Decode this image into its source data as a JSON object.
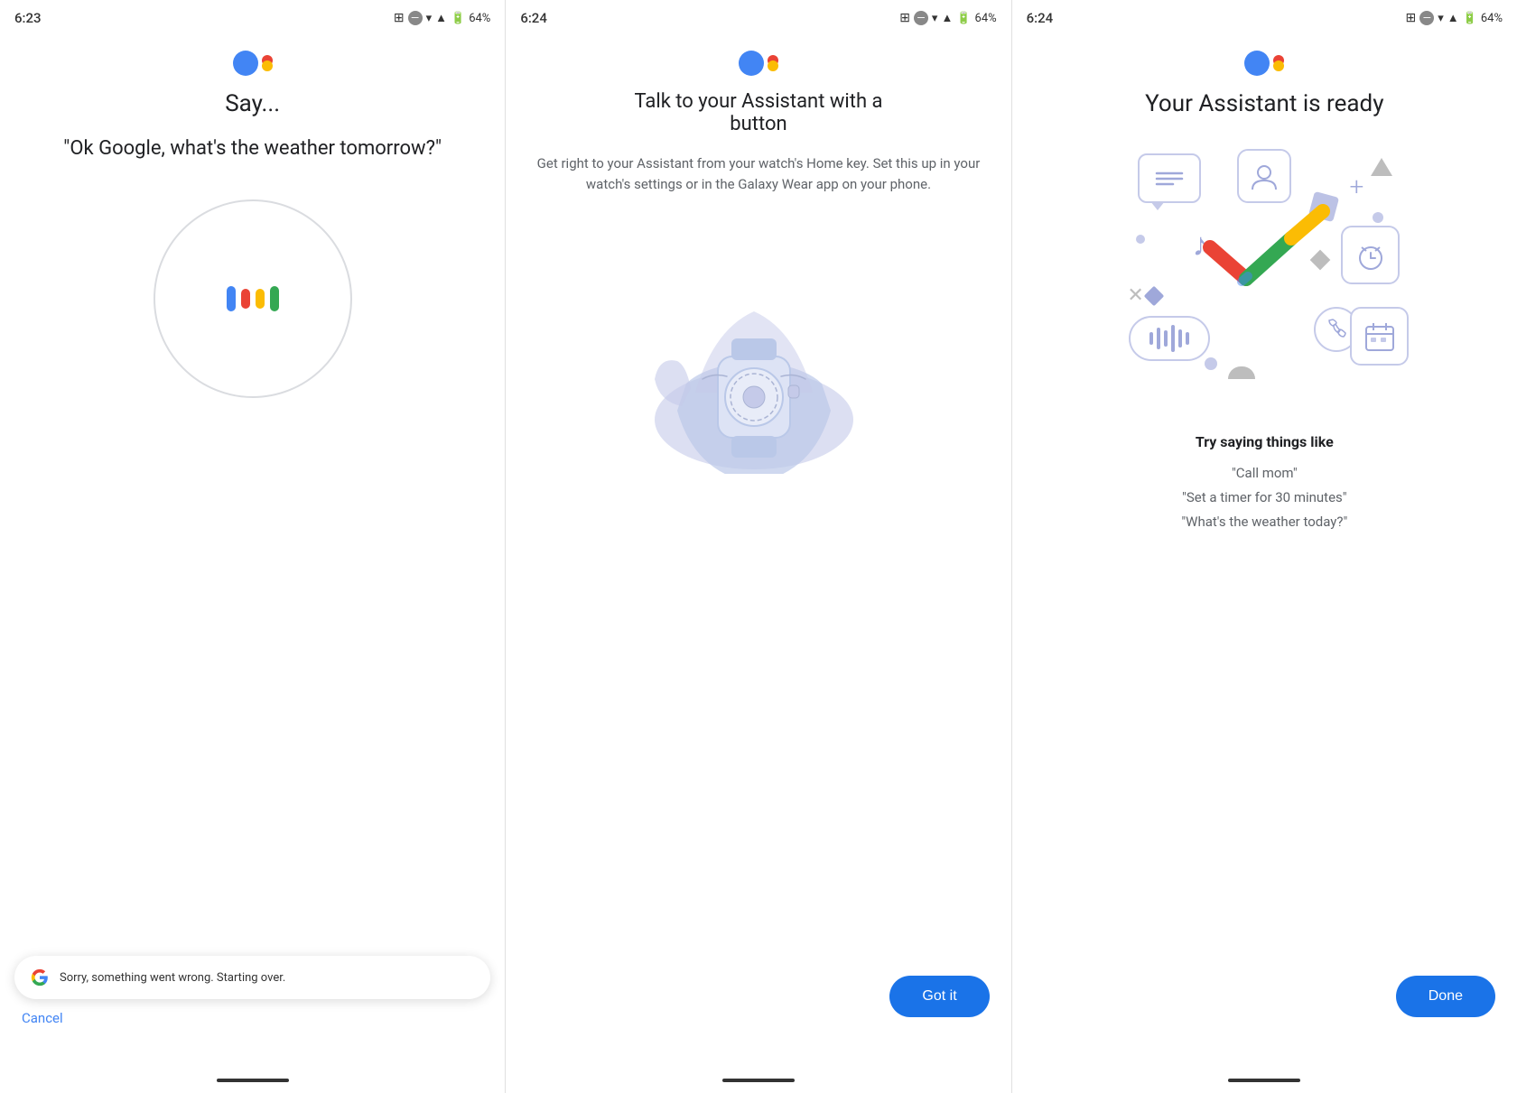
{
  "panels": [
    {
      "id": "panel1",
      "status_time": "6:23",
      "battery": "64%",
      "title": "Say...",
      "voice_query": "\"Ok Google, what's the weather tomorrow?\"",
      "error_toast": "Sorry, something went wrong. Starting over.",
      "cancel_label": "Cancel"
    },
    {
      "id": "panel2",
      "status_time": "6:24",
      "battery": "64%",
      "title": "Talk to your Assistant with a button",
      "subtitle": "Get right to your Assistant from your watch's Home key. Set this up in your watch's settings or in the Galaxy Wear app on your phone.",
      "button_label": "Got it"
    },
    {
      "id": "panel3",
      "status_time": "6:24",
      "battery": "64%",
      "title": "Your Assistant is ready",
      "try_saying_header": "Try saying things like",
      "try_examples": [
        "\"Call mom\"",
        "\"Set a timer for 30 minutes\"",
        "\"What's the weather today?\""
      ],
      "button_label": "Done"
    }
  ]
}
